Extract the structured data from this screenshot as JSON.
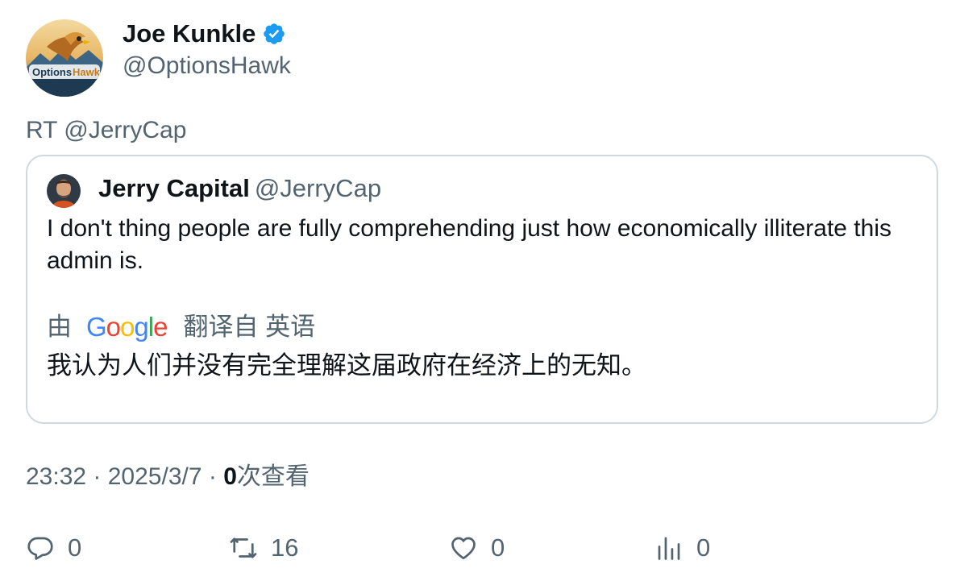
{
  "author": {
    "name": "Joe Kunkle",
    "handle": "@OptionsHawk",
    "avatar_text": "OptionsHawk",
    "verified_color": "#1d9bf0"
  },
  "retweet_line": "RT @JerryCap",
  "quote": {
    "name": "Jerry Capital",
    "handle": "@JerryCap",
    "text": "I don't thing people are fully comprehending just how economically illiterate this admin is.",
    "translation": {
      "prefix": "由",
      "provider": "Google",
      "suffix": "翻译自 英语",
      "text": "我认为人们并没有完全理解这届政府在经济上的无知。"
    }
  },
  "meta": {
    "time": "23:32",
    "sep1": " · ",
    "date": "2025/3/7",
    "sep2": " · ",
    "views_count": "0",
    "views_label": "次查看"
  },
  "actions": {
    "replies": "0",
    "retweets": "16",
    "likes": "0",
    "views": "0"
  },
  "colors": {
    "text": "#0f1419",
    "secondary": "#536471",
    "border": "#cfd9de",
    "google_blue": "#4285F4",
    "google_red": "#EA4335",
    "google_yellow": "#FBBC05",
    "google_green": "#34A853"
  }
}
